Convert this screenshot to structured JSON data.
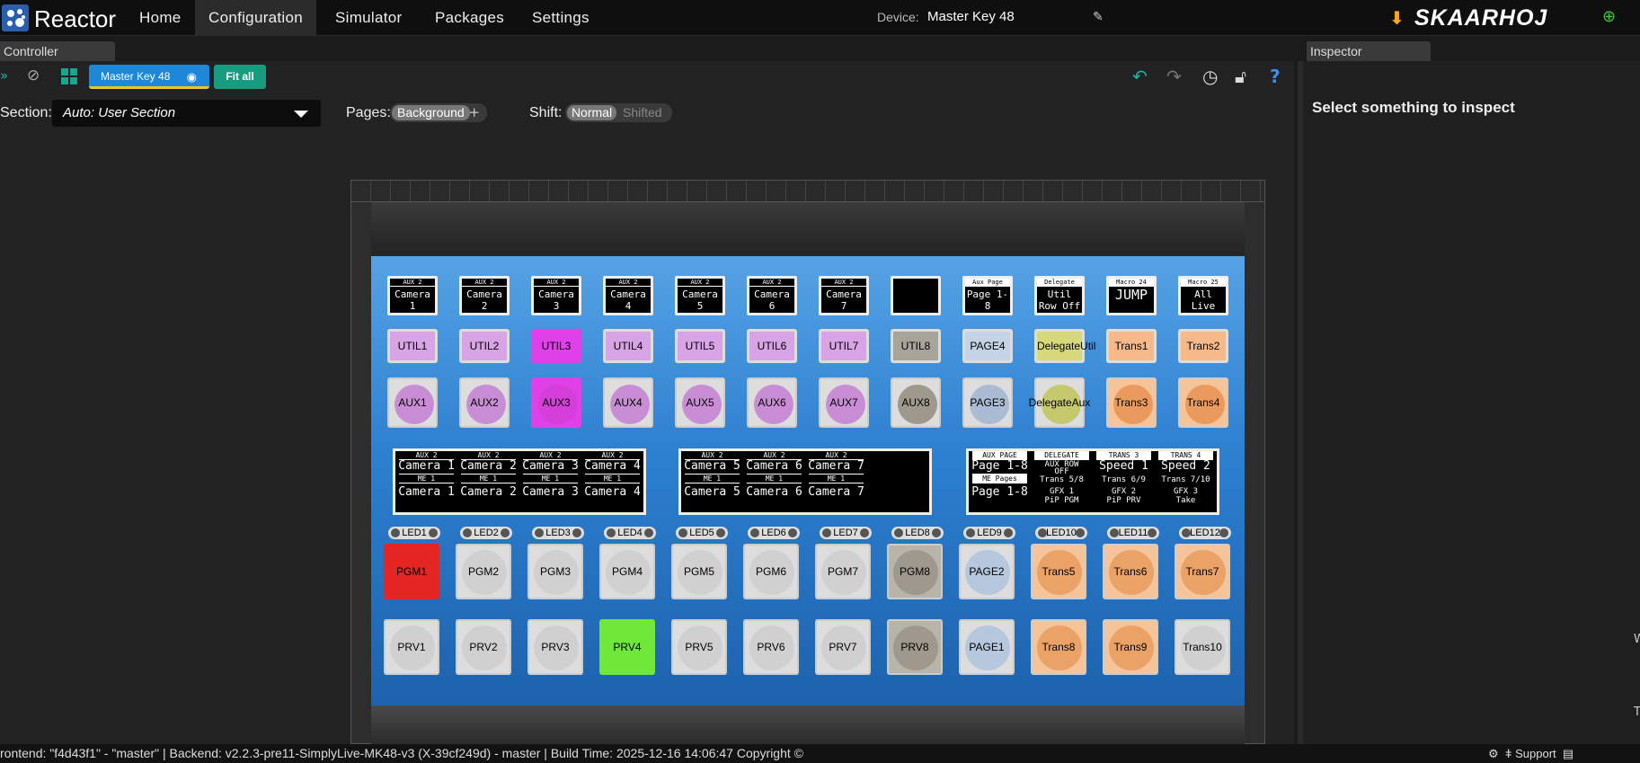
{
  "app": {
    "name": "Reactor",
    "brand": "SKAARHOJ"
  },
  "nav": {
    "items": [
      "Home",
      "Configuration",
      "Simulator",
      "Packages",
      "Settings"
    ],
    "active": "Configuration"
  },
  "device": {
    "label": "Device:",
    "name": "Master Key 48"
  },
  "icons": {
    "logo": "reactor-logo-icon",
    "download": "download-icon",
    "globe": "globe-icon",
    "edit": "pencil-icon"
  },
  "panels": {
    "controller": "Controller",
    "inspector": "Inspector",
    "inspector_message": "Select something to inspect"
  },
  "toolbar": {
    "device_button": "Master Key 48",
    "fit_all": "Fit all"
  },
  "section": {
    "label": "Section:",
    "value": "Auto: User Section"
  },
  "pages": {
    "label": "Pages:",
    "value": "Background",
    "add": "+"
  },
  "shift": {
    "label": "Shift:",
    "options": [
      "Normal",
      "Shifted"
    ],
    "selected": "Normal"
  },
  "colors": {
    "accent": "#1e88d8",
    "teal": "#179c80",
    "panel_blue": "#2c7fd0",
    "util_pink": "#d9a4e6",
    "util_magenta": "#e040e8",
    "util_grey": "#a8a49a",
    "page_blue": "#b8cbe0",
    "delegate_yellow": "#d6d87a",
    "trans_orange": "#f0a86a",
    "pgm_red": "#e52424",
    "prv_green": "#6fe83a"
  },
  "oled_row": [
    {
      "hdr": "AUX 2",
      "main": "Camera 1"
    },
    {
      "hdr": "AUX 2",
      "main": "Camera 2"
    },
    {
      "hdr": "AUX 2",
      "main": "Camera 3"
    },
    {
      "hdr": "AUX 2",
      "main": "Camera 4"
    },
    {
      "hdr": "AUX 2",
      "main": "Camera 5"
    },
    {
      "hdr": "AUX 2",
      "main": "Camera 6"
    },
    {
      "hdr": "AUX 2",
      "main": "Camera 7"
    },
    {
      "hdr": "",
      "main": ""
    },
    {
      "hdr": "Aux Page",
      "main": "Page 1-8"
    },
    {
      "hdr": "Delegate",
      "main": "Util Row Off"
    },
    {
      "hdr": "Macro 24",
      "main": "JUMP"
    },
    {
      "hdr": "Macro 25",
      "main": "All Live"
    }
  ],
  "util_row": [
    "UTIL1",
    "UTIL2",
    "UTIL3",
    "UTIL4",
    "UTIL5",
    "UTIL6",
    "UTIL7",
    "UTIL8",
    "PAGE4",
    "DelegateUtil",
    "Trans1",
    "Trans2"
  ],
  "aux_row": [
    "AUX1",
    "AUX2",
    "AUX3",
    "AUX4",
    "AUX5",
    "AUX6",
    "AUX7",
    "AUX8",
    "PAGE3",
    "DelegateAux",
    "Trans3",
    "Trans4"
  ],
  "display1": [
    {
      "hdr": "AUX 2",
      "l1": "Camera 1",
      "sub": "ME 1",
      "l2": "Camera 1"
    },
    {
      "hdr": "AUX 2",
      "l1": "Camera 2",
      "sub": "ME 1",
      "l2": "Camera 2"
    },
    {
      "hdr": "AUX 2",
      "l1": "Camera 3",
      "sub": "ME 1",
      "l2": "Camera 3"
    },
    {
      "hdr": "AUX 2",
      "l1": "Camera 4",
      "sub": "ME 1",
      "l2": "Camera 4"
    }
  ],
  "display2": [
    {
      "hdr": "AUX 2",
      "l1": "Camera 5",
      "sub": "ME 1",
      "l2": "Camera 5"
    },
    {
      "hdr": "AUX 2",
      "l1": "Camera 6",
      "sub": "ME 1",
      "l2": "Camera 6"
    },
    {
      "hdr": "AUX 2",
      "l1": "Camera 7",
      "sub": "ME 1",
      "l2": "Camera 7"
    }
  ],
  "display3": [
    {
      "hdr": "AUX PAGE",
      "l1": "Page 1-8",
      "sub": "ME Pages",
      "l2": "Page 1-8"
    },
    {
      "hdr": "DELEGATE",
      "s1": "AUX ROW",
      "s2": "OFF",
      "sub": "",
      "m1": "GFX 1",
      "m2": "Trans 5/8",
      "m3": "PiP PGM"
    },
    {
      "hdr": "TRANS 3",
      "l1": "Speed 1",
      "m2": "Trans 6/9",
      "m1": "GFX 2",
      "m3": "PiP PRV"
    },
    {
      "hdr": "TRANS 4",
      "l1": "Speed 2",
      "m2": "Trans 7/10",
      "m1": "GFX 3",
      "m3": "Take"
    }
  ],
  "leds": [
    "LED1",
    "LED2",
    "LED3",
    "LED4",
    "LED5",
    "LED6",
    "LED7",
    "LED8",
    "LED9",
    "LED10",
    "LED11",
    "LED12"
  ],
  "pgm_row": [
    "PGM1",
    "PGM2",
    "PGM3",
    "PGM4",
    "PGM5",
    "PGM6",
    "PGM7",
    "PGM8",
    "PAGE2",
    "Trans5",
    "Trans6",
    "Trans7"
  ],
  "prv_row": [
    "PRV1",
    "PRV2",
    "PRV3",
    "PRV4",
    "PRV5",
    "PRV6",
    "PRV7",
    "PRV8",
    "PAGE1",
    "Trans8",
    "Trans9",
    "Trans10"
  ],
  "footer": {
    "text": "rontend: \"f4d43f1\" - \"master\" | Backend: v2.2.3-pre11-SimplyLive-MK48-v3 (X-39cf249d) - master | Build Time: 2025-12-16 14:06:47   Copyright ©",
    "support": "Support"
  }
}
